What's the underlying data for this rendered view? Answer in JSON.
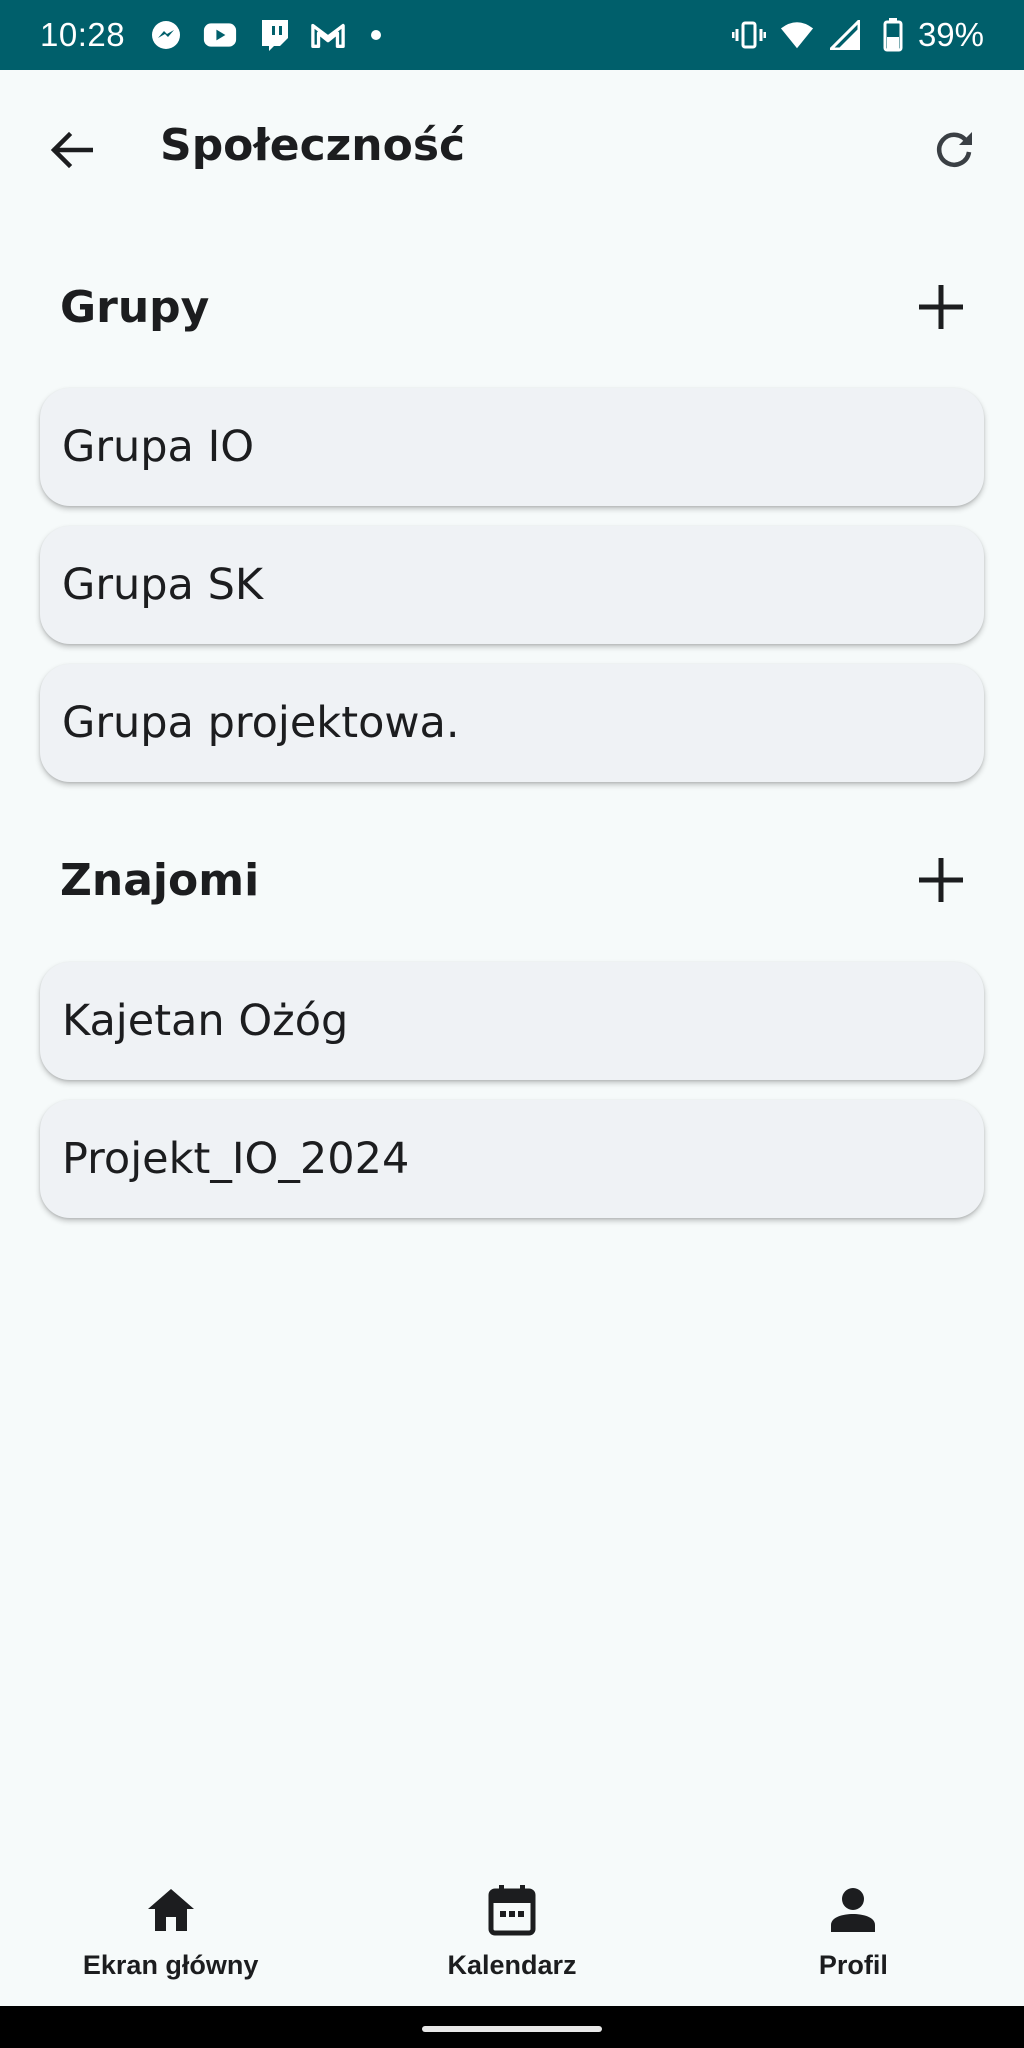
{
  "status_bar": {
    "time": "10:28",
    "battery": "39%",
    "notification_icons": [
      "messenger-icon",
      "youtube-icon",
      "twitch-icon",
      "gmail-icon",
      "dot-icon"
    ],
    "system_icons": [
      "vibrate-icon",
      "wifi-icon",
      "signal-icon",
      "battery-icon"
    ],
    "background_color": "#005f6b"
  },
  "header": {
    "title": "Społeczność",
    "back_icon": "arrow-back-icon",
    "refresh_icon": "refresh-icon"
  },
  "groups": {
    "title": "Grupy",
    "add_icon": "plus-icon",
    "items": [
      "Grupa IO",
      "Grupa SK",
      "Grupa projektowa."
    ]
  },
  "friends": {
    "title": "Znajomi",
    "add_icon": "plus-icon",
    "items": [
      "Kajetan Ożóg",
      "Projekt_IO_2024"
    ]
  },
  "bottom_nav": {
    "items": [
      {
        "label": "Ekran główny",
        "icon": "home-icon"
      },
      {
        "label": "Kalendarz",
        "icon": "calendar-icon"
      },
      {
        "label": "Profil",
        "icon": "person-icon"
      }
    ]
  }
}
